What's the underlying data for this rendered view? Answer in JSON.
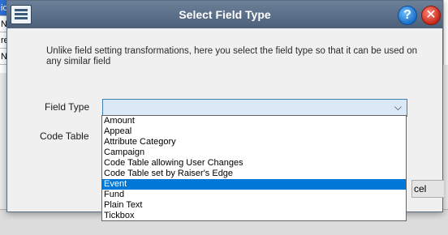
{
  "dialog": {
    "title": "Select Field Type",
    "help_glyph": "?",
    "close_glyph": "✕",
    "description": "Unlike field setting transformations, here you select the field type so that it can be used on any similar field",
    "field_type_label": "Field Type",
    "code_table_label": "Code Table",
    "combo_arrow": "⌵",
    "cancel_label": "cel"
  },
  "background": {
    "rows": [
      "io",
      "N",
      "re",
      "N"
    ]
  },
  "dropdown": {
    "items": [
      "Amount",
      "Appeal",
      "Attribute Category",
      "Campaign",
      "Code Table allowing User Changes",
      "Code Table set by Raiser's Edge",
      "Event",
      "Fund",
      "Plain Text",
      "Tickbox"
    ],
    "selected_index": 6
  },
  "icons": {
    "title": "table-list-icon",
    "help": "help-icon",
    "close": "close-icon",
    "combo": "chevron-down-icon"
  },
  "colors": {
    "titlebar": "#5a6d86",
    "selection": "#0078d7",
    "combo_bg": "#dbe9f7",
    "combo_border": "#3c7fb1"
  }
}
